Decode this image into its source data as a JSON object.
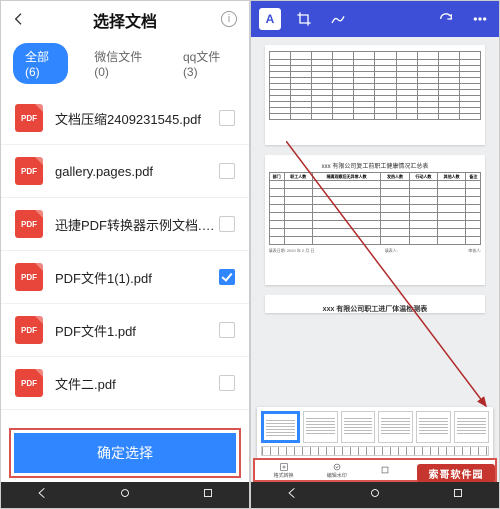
{
  "left": {
    "title": "选择文档",
    "tabs": [
      {
        "label": "全部(6)",
        "active": true
      },
      {
        "label": "微信文件(0)",
        "active": false
      },
      {
        "label": "qq文件(3)",
        "active": false
      }
    ],
    "files": [
      {
        "name": "文档压缩2409231545.pdf",
        "checked": false,
        "icon": "pdf"
      },
      {
        "name": "gallery.pages.pdf",
        "checked": false,
        "icon": "pdf"
      },
      {
        "name": "迅捷PDF转换器示例文档.pdf",
        "checked": false,
        "icon": "pdf"
      },
      {
        "name": "PDF文件1(1).pdf",
        "checked": true,
        "icon": "pdf"
      },
      {
        "name": "PDF文件1.pdf",
        "checked": false,
        "icon": "pdf"
      },
      {
        "name": "文件二.pdf",
        "checked": false,
        "icon": "pdf"
      }
    ],
    "confirm_label": "确定选择"
  },
  "right": {
    "toolbar_icons": [
      "text-A",
      "crop",
      "draw",
      "redo",
      "menu"
    ],
    "doc_titles": {
      "p2": "xxx 有限公司复工前职工健康情况汇总表",
      "p3": "xxx 有限公司职工进厂体温检测表"
    },
    "p2_headers": [
      "部门",
      "职工人数",
      "隔离观察后无异常人数",
      "发热人数",
      "行动人数",
      "其他人数",
      "备注"
    ],
    "p2_footer_left": "填表日期: 2020 年 2 月   日",
    "p2_footer_mid": "填表人:",
    "p2_footer_right": "审核人:",
    "action_labels": [
      "格式转换",
      "编辑水印",
      "",
      "",
      ""
    ],
    "watermark": "索哥软件园",
    "colors": {
      "accent": "#2f86ff",
      "danger_border": "#d9534f",
      "header": "#3c4fd6"
    }
  }
}
